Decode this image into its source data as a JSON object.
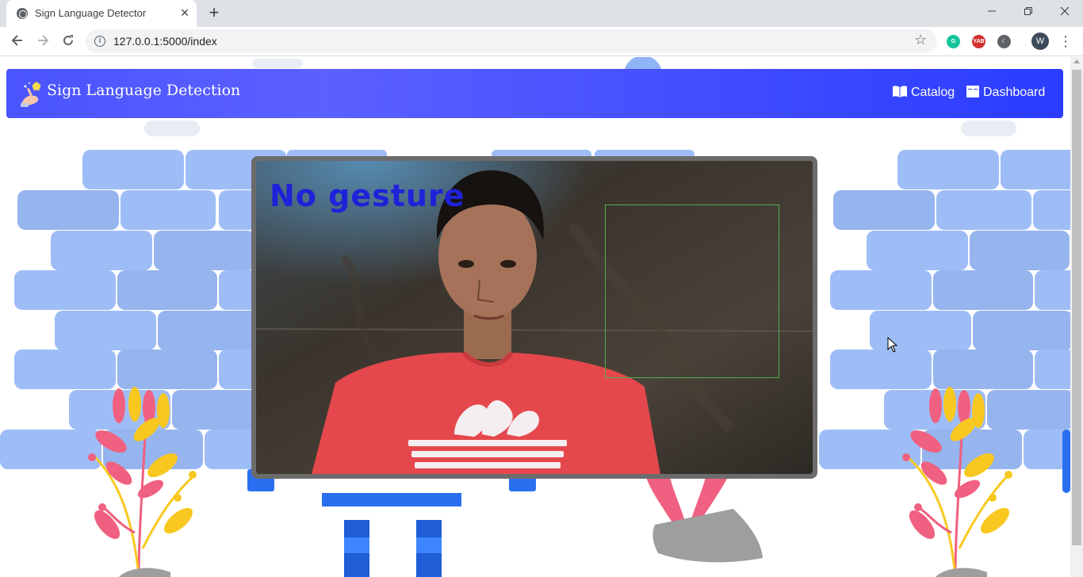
{
  "browser": {
    "tab_title": "Sign Language Detector",
    "url": "127.0.0.1:5000/index",
    "profile_initial": "W",
    "extension_labels": [
      "YAB"
    ],
    "icons": [
      "globe-icon",
      "close-icon",
      "plus-icon",
      "minimize-icon",
      "restore-icon",
      "close-window-icon",
      "back-arrow-icon",
      "forward-arrow-icon",
      "reload-icon",
      "info-icon",
      "star-icon",
      "grammarly-icon",
      "yab-icon",
      "moon-icon",
      "kebab-menu-icon"
    ]
  },
  "navbar": {
    "brand": "Sign Language Detection",
    "links": [
      {
        "label": "Catalog",
        "icon": "open-book-icon"
      },
      {
        "label": "Dashboard",
        "icon": "columns-icon"
      }
    ],
    "gradient_colors": [
      "#4a54ff",
      "#2a3cff"
    ]
  },
  "video": {
    "overlay_text": "No gesture",
    "overlay_color": "#1e22d8",
    "roi_color": "#4caf50"
  },
  "theme": {
    "brick_color": "#9ebdf7",
    "plant_pink": "#f06080",
    "plant_yellow": "#f8c820",
    "pot_grey": "#9e9e9e",
    "accent_blue": "#2a6ff0"
  }
}
